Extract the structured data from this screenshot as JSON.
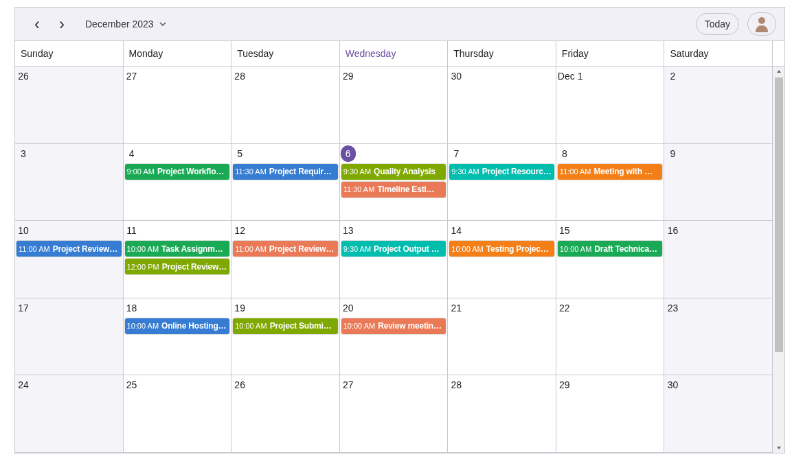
{
  "toolbar": {
    "prev": "‹",
    "next": "›",
    "period": "December 2023",
    "today": "Today"
  },
  "weekdays": [
    {
      "label": "Sunday",
      "selected": false
    },
    {
      "label": "Monday",
      "selected": false
    },
    {
      "label": "Tuesday",
      "selected": false
    },
    {
      "label": "Wednesday",
      "selected": true
    },
    {
      "label": "Thursday",
      "selected": false
    },
    {
      "label": "Friday",
      "selected": false
    },
    {
      "label": "Saturday",
      "selected": false
    }
  ],
  "weeks": [
    [
      {
        "day": "26",
        "selected": false
      },
      {
        "day": "27",
        "selected": false
      },
      {
        "day": "28",
        "selected": false
      },
      {
        "day": "29",
        "selected": false
      },
      {
        "day": "30",
        "selected": false
      },
      {
        "day": "Dec 1",
        "selected": false
      },
      {
        "day": "2",
        "selected": false
      }
    ],
    [
      {
        "day": "3",
        "selected": false
      },
      {
        "day": "4",
        "selected": false,
        "events": [
          {
            "time": "9:00 AM",
            "title": "Project Workflo…",
            "color": "#1aaa55"
          }
        ]
      },
      {
        "day": "5",
        "selected": false,
        "events": [
          {
            "time": "11:30 AM",
            "title": "Project Requir…",
            "color": "#357cd2"
          }
        ]
      },
      {
        "day": "6",
        "selected": true,
        "events": [
          {
            "time": "9:30 AM",
            "title": "Quality Analysis",
            "color": "#7fa900"
          },
          {
            "time": "11:30 AM",
            "title": "Timeline Esti…",
            "color": "#ea7a57"
          }
        ]
      },
      {
        "day": "7",
        "selected": false,
        "events": [
          {
            "time": "9:30 AM",
            "title": "Project Resourc…",
            "color": "#00bdae"
          }
        ]
      },
      {
        "day": "8",
        "selected": false,
        "events": [
          {
            "time": "11:00 AM",
            "title": "Meeting with …",
            "color": "#f57f17"
          }
        ]
      },
      {
        "day": "9",
        "selected": false
      }
    ],
    [
      {
        "day": "10",
        "selected": false,
        "events": [
          {
            "time": "11:00 AM",
            "title": "Project Review…",
            "color": "#357cd2"
          }
        ]
      },
      {
        "day": "11",
        "selected": false,
        "events": [
          {
            "time": "10:00 AM",
            "title": "Task Assignm…",
            "color": "#1aaa55"
          },
          {
            "time": "12:00 PM",
            "title": "Project Review…",
            "color": "#7fa900"
          }
        ]
      },
      {
        "day": "12",
        "selected": false,
        "events": [
          {
            "time": "11:00 AM",
            "title": "Project Review…",
            "color": "#ea7a57"
          }
        ]
      },
      {
        "day": "13",
        "selected": false,
        "events": [
          {
            "time": "9:30 AM",
            "title": "Project Output …",
            "color": "#00bdae"
          }
        ]
      },
      {
        "day": "14",
        "selected": false,
        "events": [
          {
            "time": "10:00 AM",
            "title": "Testing Projec…",
            "color": "#f57f17"
          }
        ]
      },
      {
        "day": "15",
        "selected": false,
        "events": [
          {
            "time": "10:00 AM",
            "title": "Draft Technica…",
            "color": "#1aaa55"
          }
        ]
      },
      {
        "day": "16",
        "selected": false
      }
    ],
    [
      {
        "day": "17",
        "selected": false
      },
      {
        "day": "18",
        "selected": false,
        "events": [
          {
            "time": "10:00 AM",
            "title": "Online Hosting…",
            "color": "#357cd2"
          }
        ]
      },
      {
        "day": "19",
        "selected": false,
        "events": [
          {
            "time": "10:00 AM",
            "title": "Project Submi…",
            "color": "#7fa900"
          }
        ]
      },
      {
        "day": "20",
        "selected": false,
        "events": [
          {
            "time": "10:00 AM",
            "title": "Review meetin…",
            "color": "#ea7a57"
          }
        ]
      },
      {
        "day": "21",
        "selected": false
      },
      {
        "day": "22",
        "selected": false
      },
      {
        "day": "23",
        "selected": false
      }
    ],
    [
      {
        "day": "24",
        "selected": false
      },
      {
        "day": "25",
        "selected": false
      },
      {
        "day": "26",
        "selected": false
      },
      {
        "day": "27",
        "selected": false
      },
      {
        "day": "28",
        "selected": false
      },
      {
        "day": "29",
        "selected": false
      },
      {
        "day": "30",
        "selected": false
      }
    ]
  ]
}
